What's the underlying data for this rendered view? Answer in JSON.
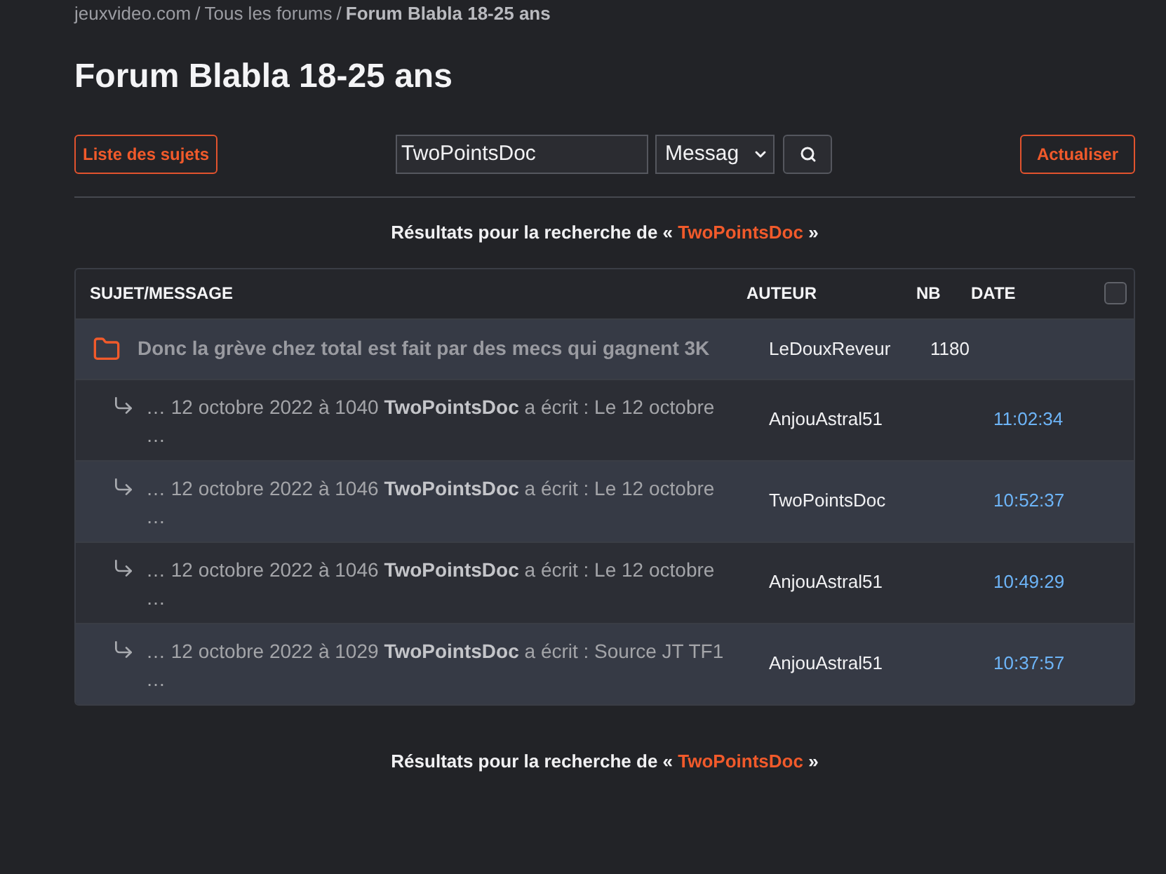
{
  "breadcrumb": [
    {
      "kind": "link",
      "label": "jeuxvideo.com"
    },
    {
      "kind": "separator",
      "label": "/"
    },
    {
      "kind": "link",
      "label": "Tous les forums"
    },
    {
      "kind": "separator",
      "label": "/"
    },
    {
      "kind": "current",
      "label": "Forum Blabla 18-25 ans"
    }
  ],
  "page_title": "Forum Blabla 18-25 ans",
  "toolbar": {
    "topics_button": "Liste des sujets",
    "search": {
      "value": "TwoPointsDoc"
    },
    "search_scope": {
      "value": "Messag"
    },
    "refresh_button": "Actualiser"
  },
  "results_top": {
    "prefix": "Résultats pour la recherche de «",
    "query": "TwoPointsDoc",
    "suffix": "»"
  },
  "table": {
    "columns": [
      "SUJET/MESSAGE",
      "AUTEUR",
      "NB",
      "DATE"
    ],
    "select_all": {
      "checked": false
    },
    "rows": [
      {
        "kind": "topic",
        "title": "Donc la grève chez total est fait par des mecs qui gagnent 3K",
        "author": "LeDouxReveur",
        "count": "1180",
        "children": [
          {
            "kind": "message",
            "excerpt": "… 12 octobre 2022 à 1040 **TwoPointsDoc** a écrit : Le 12 octobre\n…",
            "author": "AnjouAstral51",
            "date": "11:02:34"
          },
          {
            "kind": "message",
            "excerpt": "… 12 octobre 2022 à 1046 **TwoPointsDoc** a écrit : Le 12 octobre\n…",
            "author": "TwoPointsDoc",
            "date": "10:52:37"
          },
          {
            "kind": "message",
            "excerpt": "… 12 octobre 2022 à 1046 **TwoPointsDoc** a écrit : Le 12 octobre\n…",
            "author": "AnjouAstral51",
            "date": "10:49:29"
          },
          {
            "kind": "message",
            "excerpt": "… 12 octobre 2022 à 1029 **TwoPointsDoc** a écrit : Source JT TF1\n…",
            "author": "AnjouAstral51",
            "date": "10:37:57"
          }
        ]
      }
    ]
  },
  "results_bottom": {
    "prefix": "Résultats pour la recherche de «",
    "query": "TwoPointsDoc",
    "suffix": "»"
  }
}
